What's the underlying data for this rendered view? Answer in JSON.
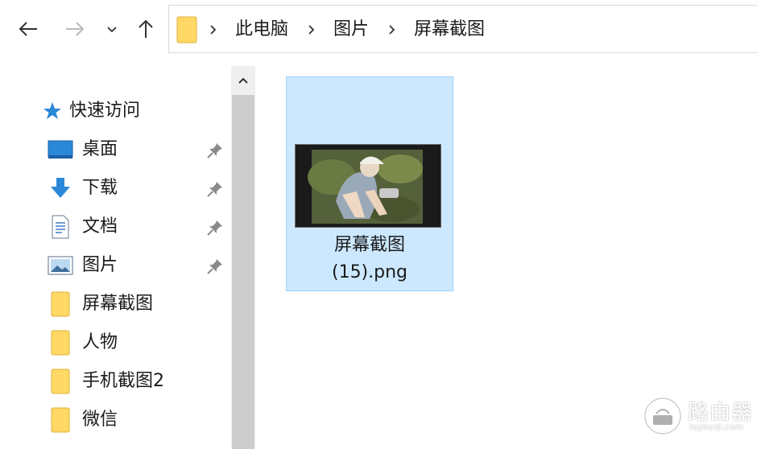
{
  "breadcrumb": [
    "此电脑",
    "图片",
    "屏幕截图"
  ],
  "quick_access": {
    "label": "快速访问",
    "icon": "star-icon"
  },
  "nav_items": [
    {
      "label": "桌面",
      "icon": "desktop-icon",
      "pinned": true
    },
    {
      "label": "下载",
      "icon": "download-icon",
      "pinned": true
    },
    {
      "label": "文档",
      "icon": "document-icon",
      "pinned": true
    },
    {
      "label": "图片",
      "icon": "pictures-icon",
      "pinned": true
    },
    {
      "label": "屏幕截图",
      "icon": "folder-icon",
      "pinned": false
    },
    {
      "label": "人物",
      "icon": "folder-icon",
      "pinned": false
    },
    {
      "label": "手机截图2",
      "icon": "folder-icon",
      "pinned": false
    },
    {
      "label": "微信",
      "icon": "folder-icon",
      "pinned": false
    }
  ],
  "file": {
    "name_line1": "屏幕截图",
    "name_line2": "(15).png",
    "selected": true
  },
  "watermark": {
    "text": "路由器",
    "sub": "luyouqi.com"
  },
  "colors": {
    "selection_bg": "#cce8ff",
    "selection_border": "#99d1ff",
    "folder": "#ffd866",
    "accent": "#2b88d8"
  }
}
